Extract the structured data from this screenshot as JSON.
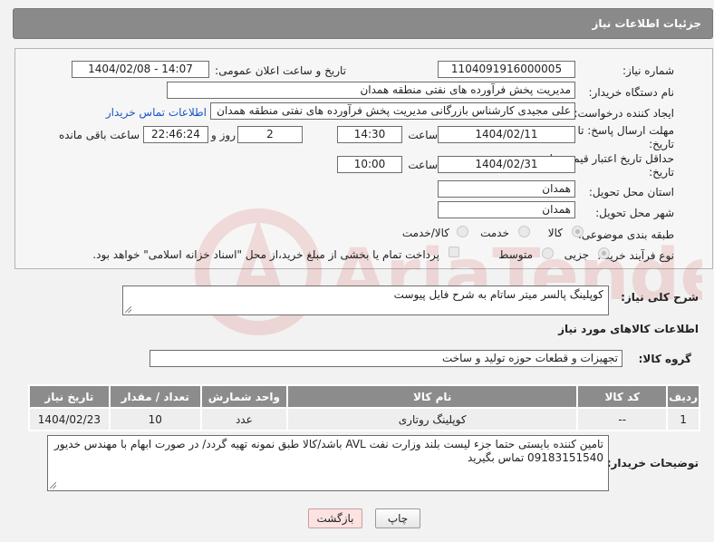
{
  "header": {
    "title": "جزئیات اطلاعات نیاز"
  },
  "fields": {
    "need_number_label": "شماره نیاز:",
    "need_number": "1104091916000005",
    "announce_label": "تاریخ و ساعت اعلان عمومی:",
    "announce_value": "1404/02/08 - 14:07",
    "buyer_org_label": "نام دستگاه خریدار:",
    "buyer_org": "مدیریت پخش فرآورده های نفتی منطقه همدان",
    "creator_label": "ایجاد کننده درخواست:",
    "creator": "علی مجیدی کارشناس بازرگانی مدیریت پخش فرآورده های نفتی منطقه همدان",
    "contact_link": "اطلاعات تماس خریدار",
    "deadline_label": "مهلت ارسال پاسخ: تا تاریخ:",
    "deadline_date": "1404/02/11",
    "time_label": "ساعت",
    "deadline_time": "14:30",
    "days_value": "2",
    "days_label": "روز و",
    "remaining_time": "22:46:24",
    "remaining_label": "ساعت باقی مانده",
    "min_price_label": "حداقل تاریخ اعتبار قیمت: تا تاریخ:",
    "price_date": "1404/02/31",
    "price_time": "10:00",
    "province_label": "استان محل تحویل:",
    "province": "همدان",
    "city_label": "شهر محل تحویل:",
    "city": "همدان",
    "category_label": "طبقه بندی موضوعی:",
    "category_options": [
      "کالا",
      "خدمت",
      "کالا/خدمت"
    ],
    "process_label": "نوع فرآیند خرید :",
    "process_options": [
      "جزیی",
      "متوسط"
    ],
    "payment_note": "پرداخت تمام یا بخشی از مبلغ خرید،از محل \"اسناد خزانه اسلامی\" خواهد بود."
  },
  "description": {
    "label": "شرح کلی نیاز:",
    "value": "کوپلینگ پالسر میتر ساتام به شرح فایل پیوست"
  },
  "goods": {
    "section_title": "اطلاعات کالاهای مورد نیاز",
    "group_label": "گروه کالا:",
    "group_value": "تجهیزات و قطعات حوزه تولید و ساخت",
    "columns": [
      "ردیف",
      "کد کالا",
      "نام کالا",
      "واحد شمارش",
      "تعداد / مقدار",
      "تاریخ نیاز"
    ],
    "rows": [
      {
        "row": "1",
        "code": "--",
        "name": "کوپلینگ روتاری",
        "unit": "عدد",
        "qty": "10",
        "date": "1404/02/23"
      }
    ]
  },
  "buyer_notes": {
    "label": "توضیحات خریدار:",
    "value": "تامین کننده بایستی حتما جزء لیست بلند وزارت نفت AVL باشد/کالا طبق نمونه تهیه گردد/ در صورت ابهام با مهندس خدیور 09183151540 تماس بگیرید"
  },
  "buttons": {
    "print": "چاپ",
    "back": "بازگشت"
  },
  "colors": {
    "header_bg": "#8a8a8a",
    "table_header_bg": "#8c8c8c",
    "back_button_bg": "#fde2e2",
    "link": "#1a56c8"
  }
}
